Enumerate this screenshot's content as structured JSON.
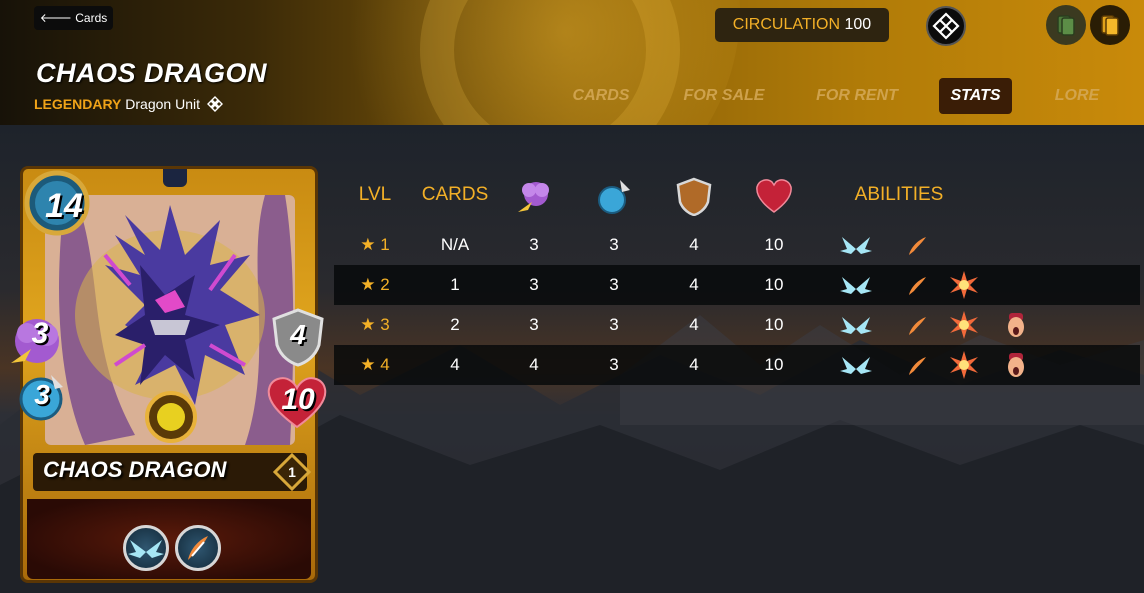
{
  "header": {
    "back_label": "Cards",
    "title": "CHAOS DRAGON",
    "rarity": "LEGENDARY",
    "type_label": "Dragon Unit",
    "circulation_label": "CIRCULATION",
    "circulation_value": "100"
  },
  "tabs": [
    {
      "label": "CARDS",
      "active": false
    },
    {
      "label": "FOR SALE",
      "active": false
    },
    {
      "label": "FOR RENT",
      "active": false
    },
    {
      "label": "STATS",
      "active": true
    },
    {
      "label": "LORE",
      "active": false
    }
  ],
  "card": {
    "name": "CHAOS DRAGON",
    "mana": "14",
    "attack": "3",
    "ranged": "3",
    "armor": "4",
    "health": "10",
    "level": "1",
    "abilities": [
      "void-wings-icon",
      "flame-feather-icon"
    ]
  },
  "stats_table": {
    "headers": [
      "LVL",
      "CARDS",
      "magic-attack-icon",
      "speed-icon",
      "armor-icon",
      "health-icon",
      "ABILITIES"
    ],
    "columns_text": {
      "lvl": "LVL",
      "cards": "CARDS",
      "abilities": "ABILITIES"
    },
    "rows": [
      {
        "lvl": "★ 1",
        "cards": "N/A",
        "magic": "3",
        "speed": "3",
        "armor": "4",
        "health": "10",
        "abilities": [
          "void-wings-icon",
          "flame-feather-icon"
        ]
      },
      {
        "lvl": "★ 2",
        "cards": "1",
        "magic": "3",
        "speed": "3",
        "armor": "4",
        "health": "10",
        "abilities": [
          "void-wings-icon",
          "flame-feather-icon",
          "blast-icon"
        ]
      },
      {
        "lvl": "★ 3",
        "cards": "2",
        "magic": "3",
        "speed": "3",
        "armor": "4",
        "health": "10",
        "abilities": [
          "void-wings-icon",
          "flame-feather-icon",
          "blast-icon",
          "screaming-head-icon"
        ]
      },
      {
        "lvl": "★ 4",
        "cards": "4",
        "magic": "4",
        "speed": "3",
        "armor": "4",
        "health": "10",
        "abilities": [
          "void-wings-icon",
          "flame-feather-icon",
          "blast-icon",
          "screaming-head-icon"
        ]
      }
    ]
  },
  "colors": {
    "accent": "#f3b027",
    "rarity": "#f0a318",
    "active_tab_bg": "#3a1d06"
  }
}
